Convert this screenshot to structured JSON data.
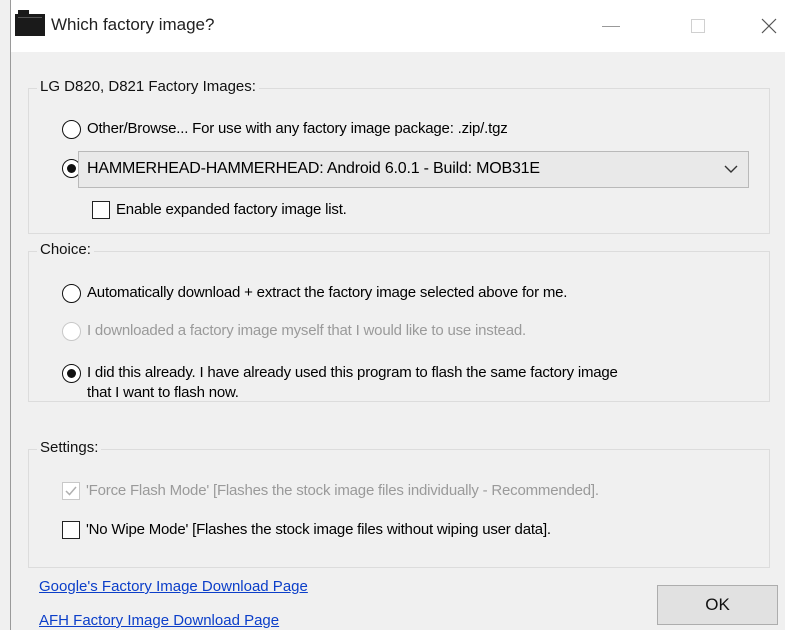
{
  "window": {
    "title": "Which factory image?"
  },
  "factory_images": {
    "group_label": "LG D820, D821 Factory Images:",
    "other_browse_label": "Other/Browse...  For use with any factory image package: .zip/.tgz",
    "selected_image": "HAMMERHEAD-HAMMERHEAD: Android 6.0.1 - Build: MOB31E",
    "expanded_list_label": "Enable expanded factory image list."
  },
  "choice": {
    "group_label": "Choice:",
    "auto_download_label": "Automatically download + extract the factory image selected above for me.",
    "downloaded_myself_label": "I downloaded a factory image myself that I would like to use instead.",
    "already_done_line1": "I did this already. I have already used this program to flash the same factory image",
    "already_done_line2": "that I want to flash now."
  },
  "settings": {
    "group_label": "Settings:",
    "force_flash_label": "'Force Flash Mode' [Flashes the stock image files individually - Recommended].",
    "no_wipe_label": "'No Wipe Mode' [Flashes the stock image files without wiping user data]."
  },
  "links": {
    "google_link": "Google's Factory Image Download Page",
    "afh_link": "AFH Factory Image Download Page"
  },
  "buttons": {
    "ok_label": "OK"
  }
}
